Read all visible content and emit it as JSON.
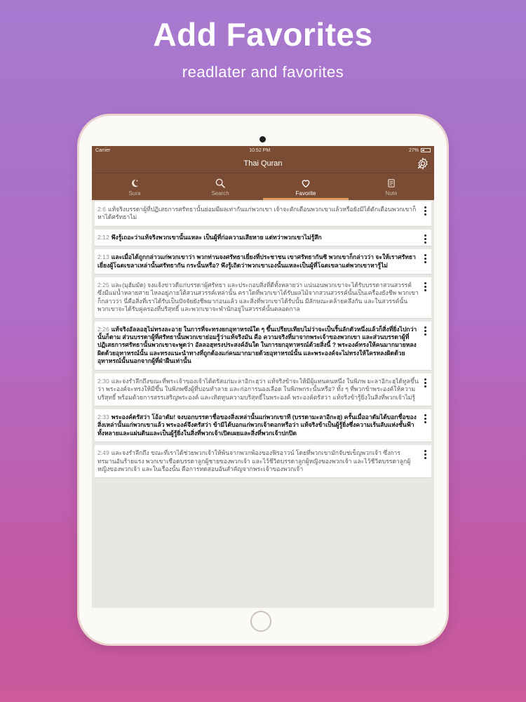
{
  "hero": {
    "title": "Add Favorites",
    "subtitle": "readlater and favorites"
  },
  "status": {
    "carrier": "Carrier",
    "time": "10:52 PM",
    "battery": "27%"
  },
  "app": {
    "title": "Thai Quran",
    "settings_icon": "settings-gear-icon"
  },
  "tabs": [
    {
      "label": "Sura",
      "icon": "moon-icon",
      "active": false
    },
    {
      "label": "Search",
      "icon": "search-icon",
      "active": false
    },
    {
      "label": "Favorite",
      "icon": "heart-icon",
      "active": true
    },
    {
      "label": "Note",
      "icon": "note-icon",
      "active": false
    }
  ],
  "verses": [
    {
      "num": "2:6",
      "style": "light",
      "text": "แท้จริงบรรดาผู้ที่ปฏิเสธการศรัทธานั้นย่อมมีผลเท่ากันแก่พวกเขา เจ้าจะตักเตือนพวกเขาแล้วหรือยังมิได้ตักเตือนพวกเขาก็หาได้ศรัทธาไม่"
    },
    {
      "num": "2:12",
      "style": "bold",
      "text": "พึงรู้เถอะว่าแท้จริงพวกเขานั้นแหละ เป็นผู้ที่ก่อความเสียหาย แต่ทว่าพวกเขาไม่รู้สึก"
    },
    {
      "num": "2:13",
      "style": "bold",
      "text": "และเมื่อได้ถูกกล่าวแก่พวกเขาว่า พวกท่านจงศรัทธาเยี่ยงที่ประชาชน เขาศรัทธากันซิ พวกเขาก็กล่าวว่า จะให้เราศรัทธาเยี่ยงผู้โฉดเขลาเหล่านั้นศรัทธากัน กระนั้นหรือ? พึงรู้เถิดว่าพวกเขาเองนั้นแหละเป็นผู้ที่โฉดเขลาแต่พวกเขาหารู้ไม่"
    },
    {
      "num": "2:25",
      "style": "light",
      "text": "และ(มุฮัมมัด) จงแจ้งข่าวดีแก่บรรดาผู้ศรัทธา และประกอบสิ่งที่ดีทั้งหลายว่า แน่นอนพวกเขาจะได้รับบรรดาสวนสวรรค์ ซึ่งมีแม่น้ำหลายสาย ไหลอยู่ภายใต้สวนสวรรค์เหล่านั้น คราใดที่พวกเขาได้รับผลไม้จากสวนสวรรค์นั้นเป็นเครื่องยังชีพ พวกเขาก็กล่าวว่า นี่คือสิ่งที่เราได้รับเป็นปัจจัยยังชีพมาก่อนแล้ว และสิ่งที่พวกเขาได้รับนั้น มีลักษณะคล้ายคลึงกัน และในสวรรค์นั้น พวกเขาจะได้รับคู่ครองที่บริสุทธิ์ และพวกเขาจะพำนักอยู่ในสวรรค์นั้นตลอดกาล"
    },
    {
      "num": "2:26",
      "style": "bold",
      "text": "แท้จริงอัลลอฮฺไม่ทรงละอาย ในการที่จะทรงยกอุทาหรณ์ใด ๆ ขึ้นเปรียบเทียบไม่ว่าจะเป็นริ้นลักตัวหนึ่งแล้วก็สิ่งที่ยิ่งไปกว่านั้นก็ตาม ส่วนบรรดาผู้ที่ศรัทธานั้นพวกเขาย่อมรู้ว่าแท้จริงมัน คือ ความจริงที่มาจากพระเจ้าของพวกเขา และส่วนบรรดาผู้ที่ปฏิเสธการศรัทธานั้นพวกเขาจะพูดว่า อัลลอฮฺทรงประสงค์อันใด ในการยกอุทาหรณ์ด้วยสิ่งนี้ ? พระองค์ทรงให้คนมากมายหลงผิดด้วยอุทาหรณ์นั้น และทรงแนะนำทางที่ถูกต้องแก่คนมากมายด้วยอุทาหรณ์นั้น และพระองค์จะไม่ทรงให้ใครหลงผิดด้วยอุทาหรณ์นั้นนอกจากผู้ที่ฝ่าฝืนเท่านั้น"
    },
    {
      "num": "2:30",
      "style": "light",
      "text": "และจงรำลึกถึงขณะที่พระเจ้าของเจ้าได้ตรัสแก่มะลาอิกะฮฺว่า แท้จริงข้าจะให้มีผู้แทนคนหนึ่ง ในพิภพ มะลาอิกะฮฺได้ทูลขึ้นว่า พระองค์จะทรงให้มีขึ้น ในพิภพซึ่งผู้ที่บ่อนทำลาย และก่อการนองเลือด ในพิภพกระนั้นหรือ? ทั้ง ๆ ที่พวกข้าพระองค์ให้ความบริสุทธิ์ พร้อมด้วยการสรรเสริญพระองค์ และเทิดทูนความบริสุทธิ์ในพระองค์ พระองค์ตรัสว่า แท้จริงข้ารู้ยิ่งในสิ่งที่พวกเจ้าไม่รู้"
    },
    {
      "num": "2:33",
      "style": "bold",
      "text": "พระองค์ตรัสว่า โอ้อาดัม! จงบอกบรรดาชื่อของสิ่งเหล่านั้นแก่พวกเขาที (บรรดามะลาอิกะฮฺ) ครั้นเมื่ออาดัมได้บอกชื่อของสิ่งเหล่านั้นแก่พวกเขาแล้ว พระองค์จึงตรัสว่า ข้ามิได้บอกแก่พวกเจ้าดอกหรือว่า แท้จริงข้าเป็นผู้รู้ยิ่งซึ่งความเร้นลับแห่งชั้นฟ้าทั้งหลายและแผ่นดินและเป็นผู้รู้ยิ่งในสิ่งที่พวกเจ้าเปิดเผยและสิ่งที่พวกเจ้าปกปิด"
    },
    {
      "num": "2:49",
      "style": "light",
      "text": "และจงรำลึกถึง ขณะที่เราได้ช่วยพวกเจ้าให้พ้นจากพวกพ้องของฟิรอาวน์ โดยที่พวกเขามักจับช่เข็ญพวกเจ้า ซึ่งการทรมานอันร้ายแรง พวกเขาเชือดบรรดาลูกผู้ชายของพวกเจ้า และไว้ชีวิตบรรดาลูกผู้หญิงของพวกเจ้า และไว้ชีวิตบรรดาลูกผู้หญิงของพวกเจ้า และในเรื่องนั้น คือการทดสอบอันสำคัญจากพระเจ้าของพวกเจ้า"
    }
  ]
}
